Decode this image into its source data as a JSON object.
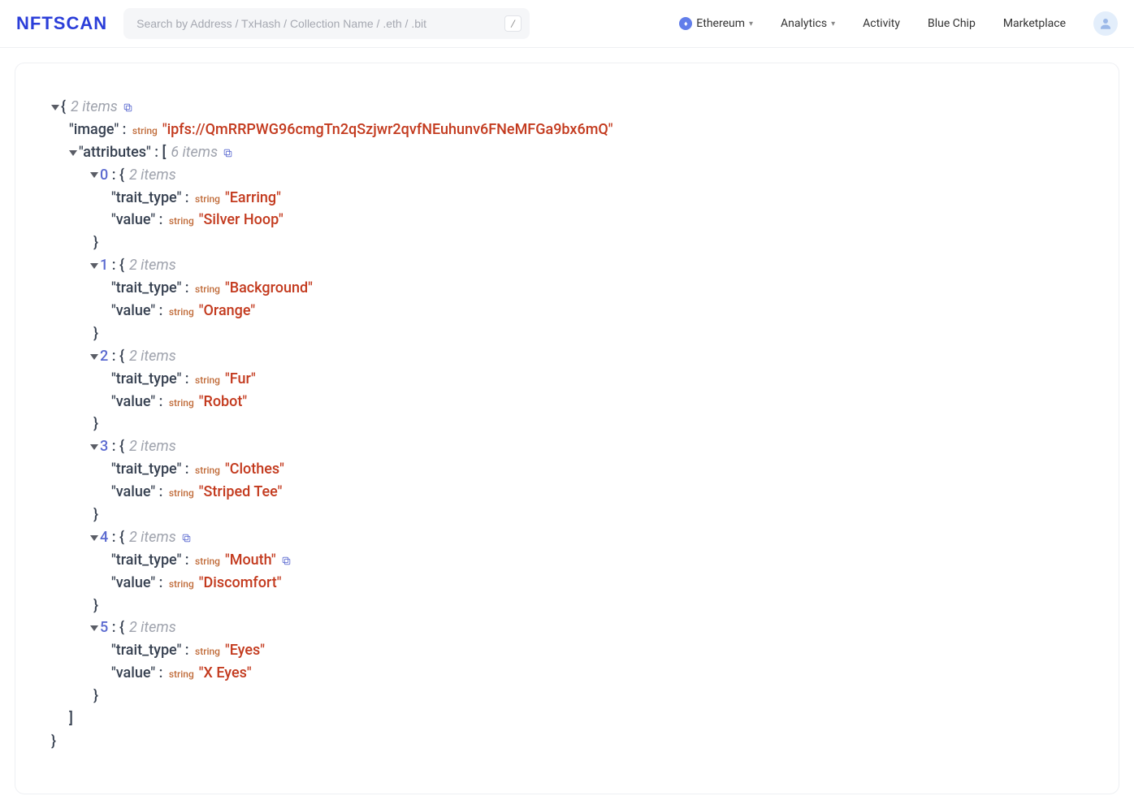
{
  "header": {
    "logo_text": "NFTSCAN",
    "search_placeholder": "Search by Address / TxHash / Collection Name / .eth / .bit",
    "search_kbd": "/",
    "nav": {
      "chain": "Ethereum",
      "analytics": "Analytics",
      "activity": "Activity",
      "blue_chip": "Blue Chip",
      "marketplace": "Marketplace"
    }
  },
  "json": {
    "root_count": "2 items",
    "image_key": "\"image\"",
    "type_string": "string",
    "image_val": "\"ipfs://QmRRPWG96cmgTn2qSzjwr2qvfNEuhunv6FNeMFGa9bx6mQ\"",
    "attributes_key": "\"attributes\"",
    "attributes_count": "6 items",
    "open_brace": "{",
    "close_brace": "}",
    "open_bracket": "[",
    "close_bracket": "]",
    "colon": " : ",
    "trait_key": "\"trait_type\"",
    "value_key": "\"value\"",
    "two_items": "2 items",
    "items": [
      {
        "idx": "0",
        "trait": "\"Earring\"",
        "value": "\"Silver Hoop\""
      },
      {
        "idx": "1",
        "trait": "\"Background\"",
        "value": "\"Orange\""
      },
      {
        "idx": "2",
        "trait": "\"Fur\"",
        "value": "\"Robot\""
      },
      {
        "idx": "3",
        "trait": "\"Clothes\"",
        "value": "\"Striped Tee\""
      },
      {
        "idx": "4",
        "trait": "\"Mouth\"",
        "value": "\"Discomfort\"",
        "copy_trait": true
      },
      {
        "idx": "5",
        "trait": "\"Eyes\"",
        "value": "\"X Eyes\""
      }
    ],
    "copy_root": true,
    "copy_attributes": true,
    "copy_item4_header": true
  }
}
